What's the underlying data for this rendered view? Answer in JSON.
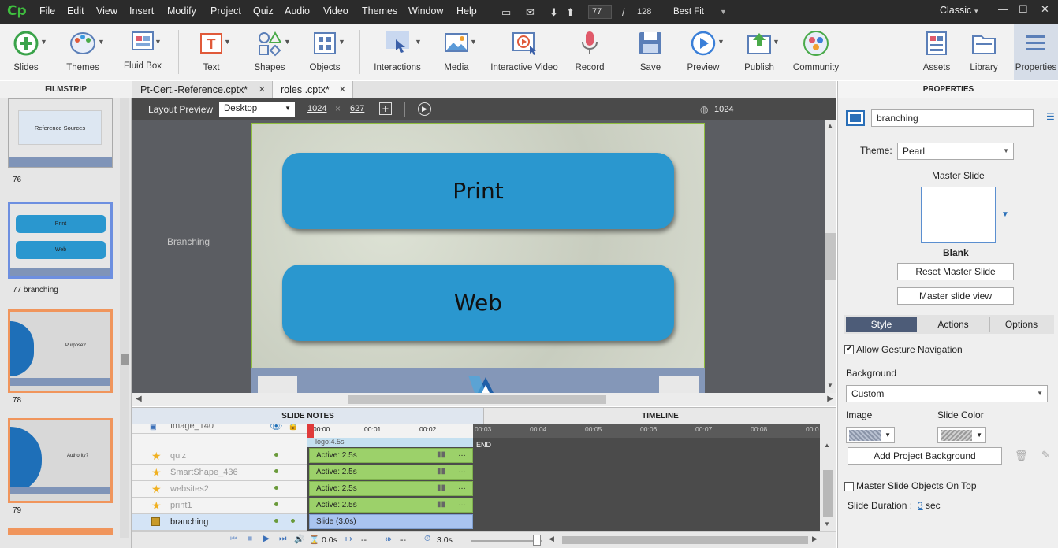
{
  "app": {
    "logo": "Cp"
  },
  "menu": [
    "File",
    "Edit",
    "View",
    "Insert",
    "Modify",
    "Project",
    "Quiz",
    "Audio",
    "Video",
    "Themes",
    "Window",
    "Help"
  ],
  "nav": {
    "current_slide": "77",
    "separator": "/",
    "total_slides": "128",
    "zoom": "Best Fit",
    "workspace": "Classic"
  },
  "toolbar": {
    "slides": "Slides",
    "themes": "Themes",
    "fluid_box": "Fluid Box",
    "text": "Text",
    "shapes": "Shapes",
    "objects": "Objects",
    "interactions": "Interactions",
    "media": "Media",
    "interactive_video": "Interactive Video",
    "record": "Record",
    "save": "Save",
    "preview": "Preview",
    "publish": "Publish",
    "community": "Community",
    "assets": "Assets",
    "library": "Library",
    "properties": "Properties"
  },
  "filmstrip": {
    "title": "FILMSTRIP",
    "slides": [
      {
        "num": "76",
        "caption": "Reference Sources"
      },
      {
        "num": "77 branching",
        "btn1": "Print",
        "btn2": "Web"
      },
      {
        "num": "78",
        "caption": "Purpose?"
      },
      {
        "num": "79",
        "caption": "Authority?"
      }
    ]
  },
  "doc_tabs": [
    {
      "label": "Pt-Cert.-Reference.cptx*"
    },
    {
      "label": "roles .cptx*"
    }
  ],
  "layout_preview": {
    "label": "Layout Preview",
    "device": "Desktop",
    "width": "1024",
    "times": "×",
    "height": "627",
    "ruler": "1024"
  },
  "stage": {
    "side_label": "Branching",
    "button1": "Print",
    "button2": "Web"
  },
  "panels": {
    "slide_notes": "SLIDE NOTES",
    "timeline": "TIMELINE"
  },
  "timeline": {
    "ticks": [
      "00:00",
      "00:01",
      "00:02",
      "00:03",
      "00:04",
      "00:05",
      "00:06",
      "00:07",
      "00:08",
      "00:0"
    ],
    "end_label": "END",
    "top_partial": "Image_140",
    "top_bar": "logo:4.5s",
    "rows": [
      {
        "name": "quiz",
        "bar": "Active: 2.5s"
      },
      {
        "name": "SmartShape_436",
        "bar": "Active: 2.5s"
      },
      {
        "name": "websites2",
        "bar": "Active: 2.5s"
      },
      {
        "name": "print1",
        "bar": "Active: 2.5s"
      },
      {
        "name": "branching",
        "bar": "Slide (3.0s)"
      }
    ],
    "bottom": {
      "start": "0.0s",
      "mid1": "--",
      "mid2": "--",
      "duration": "3.0s"
    }
  },
  "properties": {
    "title": "PROPERTIES",
    "name": "branching",
    "theme_label": "Theme:",
    "theme_value": "Pearl",
    "master_slide_label": "Master Slide",
    "master_name": "Blank",
    "reset_master": "Reset Master Slide",
    "master_view": "Master slide view",
    "tabs": [
      "Style",
      "Actions",
      "Options"
    ],
    "allow_gesture": "Allow Gesture Navigation",
    "background_label": "Background",
    "background_value": "Custom",
    "image_label": "Image",
    "slide_color_label": "Slide Color",
    "add_bg": "Add Project Background",
    "master_on_top": "Master Slide Objects On Top",
    "slide_duration_label": "Slide Duration :",
    "slide_duration_value": "3",
    "slide_duration_unit": "sec"
  },
  "colors": {
    "accent": "#2a97cf",
    "selected_thumb": "#6d8fe0",
    "warn_thumb": "#f0955c",
    "active_bar": "#9cd16a"
  }
}
